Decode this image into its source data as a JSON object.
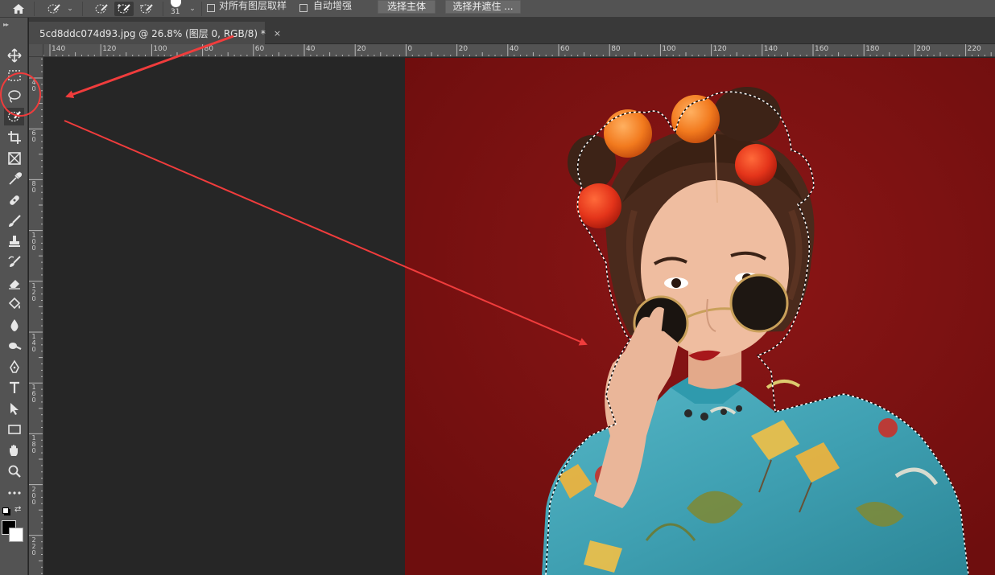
{
  "options_bar": {
    "brush_size": "31",
    "sample_all_layers_label": "对所有图层取样",
    "auto_enhance_label": "自动增强",
    "select_subject_label": "选择主体",
    "select_and_mask_label": "选择并遮住 ..."
  },
  "document": {
    "tab_title": "5cd8ddc074d93.jpg @ 26.8% (图层 0, RGB/8) *",
    "close_glyph": "×"
  },
  "ruler_top": {
    "labels": [
      "140",
      "120",
      "100",
      "80",
      "60",
      "40",
      "20",
      "0",
      "20",
      "40",
      "60",
      "80",
      "100",
      "120",
      "140",
      "160",
      "180",
      "200",
      "220"
    ]
  },
  "ruler_left": {
    "labels": [
      "40",
      "60",
      "80",
      "100",
      "120",
      "140",
      "160",
      "180",
      "200",
      "220"
    ]
  },
  "tools": [
    {
      "name": "move-tool",
      "icon": "move-icon"
    },
    {
      "name": "marquee-tool",
      "icon": "rect-marquee-icon"
    },
    {
      "name": "lasso-tool",
      "icon": "lasso-icon"
    },
    {
      "name": "quick-selection-tool",
      "icon": "quick-selection-icon",
      "active": true
    },
    {
      "name": "crop-tool",
      "icon": "crop-icon"
    },
    {
      "name": "frame-tool",
      "icon": "frame-icon"
    },
    {
      "name": "eyedropper-tool",
      "icon": "eyedropper-icon"
    },
    {
      "name": "healing-brush-tool",
      "icon": "bandage-icon"
    },
    {
      "name": "brush-tool",
      "icon": "brush-icon"
    },
    {
      "name": "clone-stamp-tool",
      "icon": "stamp-icon"
    },
    {
      "name": "history-brush-tool",
      "icon": "history-brush-icon"
    },
    {
      "name": "eraser-tool",
      "icon": "eraser-icon"
    },
    {
      "name": "paint-bucket-tool",
      "icon": "paint-bucket-icon"
    },
    {
      "name": "blur-tool",
      "icon": "drop-icon"
    },
    {
      "name": "dodge-tool",
      "icon": "dodge-icon"
    },
    {
      "name": "pen-tool",
      "icon": "pen-icon"
    },
    {
      "name": "type-tool",
      "icon": "type-icon"
    },
    {
      "name": "path-selection-tool",
      "icon": "arrow-cursor-icon"
    },
    {
      "name": "rectangle-tool",
      "icon": "rectangle-icon"
    },
    {
      "name": "hand-tool",
      "icon": "hand-icon"
    },
    {
      "name": "zoom-tool",
      "icon": "magnifier-icon"
    },
    {
      "name": "more-tools",
      "icon": "ellipsis-icon"
    }
  ],
  "colors": {
    "foreground": "#000000",
    "background": "#ffffff",
    "canvas_bg": "#7e1111",
    "annotation": "#f03c3c"
  }
}
